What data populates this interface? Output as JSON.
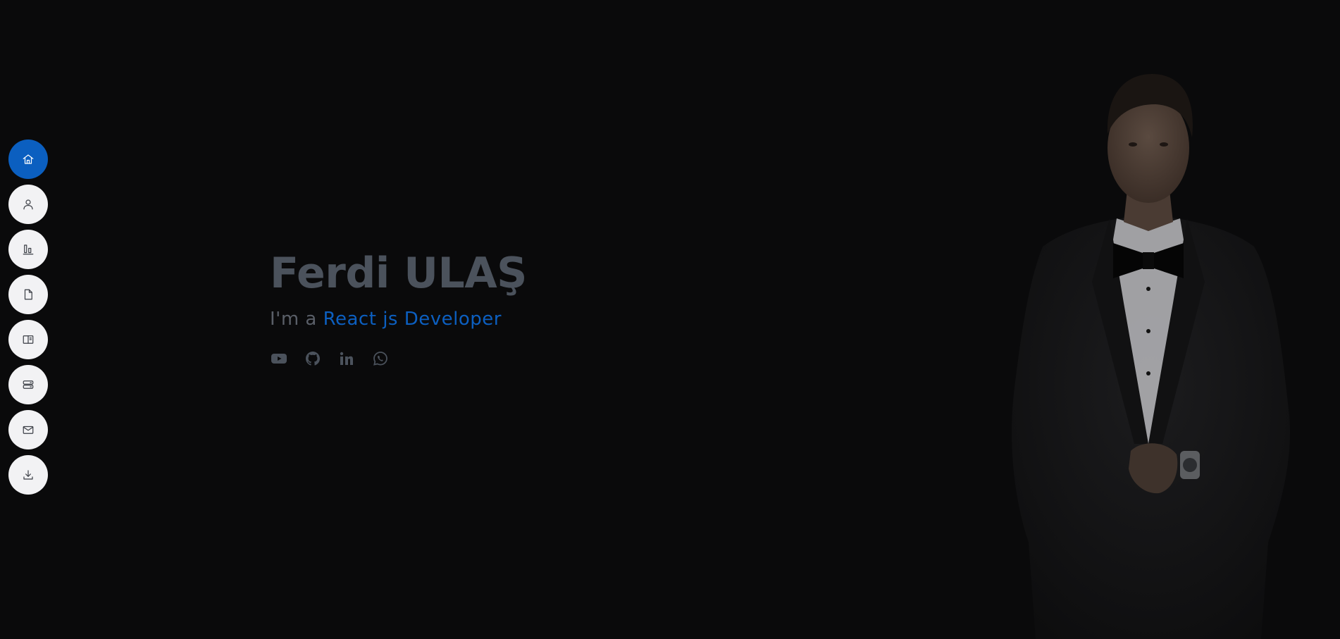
{
  "nav": {
    "items": [
      {
        "icon": "home-icon",
        "active": true
      },
      {
        "icon": "user-icon",
        "active": false
      },
      {
        "icon": "chart-icon",
        "active": false
      },
      {
        "icon": "file-icon",
        "active": false
      },
      {
        "icon": "book-icon",
        "active": false
      },
      {
        "icon": "server-icon",
        "active": false
      },
      {
        "icon": "mail-icon",
        "active": false
      },
      {
        "icon": "download-icon",
        "active": false
      }
    ]
  },
  "hero": {
    "name": "Ferdi ULAŞ",
    "role_prefix": "I'm a",
    "role_highlight": "React js Developer"
  },
  "social": {
    "icons": [
      "youtube-icon",
      "github-icon",
      "linkedin-icon",
      "whatsapp-icon"
    ]
  },
  "colors": {
    "background": "#0a0a0b",
    "accent": "#0b5fc0",
    "name_text": "#4b525c",
    "nav_button": "#f2f2f4"
  }
}
